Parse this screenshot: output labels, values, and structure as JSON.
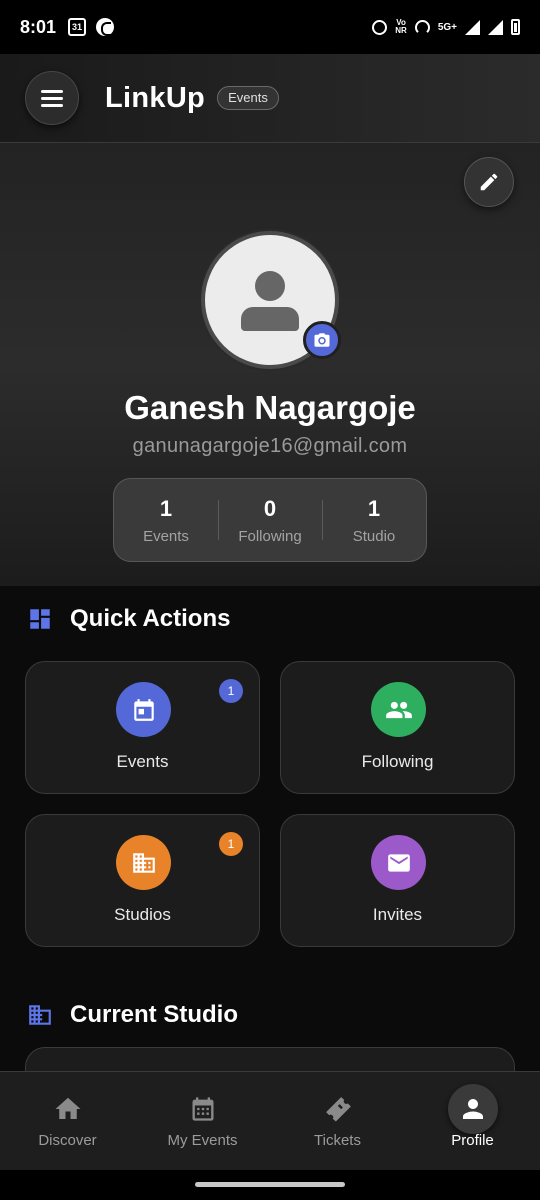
{
  "status_bar": {
    "time": "8:01",
    "calendar_date": "31",
    "volte": "Vo\nNR",
    "network": "5G+"
  },
  "header": {
    "title": "LinkUp",
    "badge": "Events"
  },
  "profile": {
    "name": "Ganesh Nagargoje",
    "email": "ganunagargoje16@gmail.com",
    "stats": [
      {
        "value": "1",
        "label": "Events"
      },
      {
        "value": "0",
        "label": "Following"
      },
      {
        "value": "1",
        "label": "Studio"
      }
    ]
  },
  "quick_actions": {
    "title": "Quick Actions",
    "cards": [
      {
        "label": "Events",
        "badge": "1",
        "icon": "calendar-icon",
        "color": "#5468d8",
        "badge_color": "#5468d8"
      },
      {
        "label": "Following",
        "badge": "",
        "icon": "people-icon",
        "color": "#2eaf5f"
      },
      {
        "label": "Studios",
        "badge": "1",
        "icon": "building-icon",
        "color": "#e8832a",
        "badge_color": "#e8832a"
      },
      {
        "label": "Invites",
        "badge": "",
        "icon": "mail-icon",
        "color": "#9b59c9"
      }
    ]
  },
  "current_studio": {
    "title": "Current Studio"
  },
  "bottom_nav": {
    "items": [
      {
        "label": "Discover",
        "icon": "home-icon",
        "active": false
      },
      {
        "label": "My Events",
        "icon": "calendar-grid-icon",
        "active": false
      },
      {
        "label": "Tickets",
        "icon": "ticket-icon",
        "active": false
      },
      {
        "label": "Profile",
        "icon": "person-icon",
        "active": true
      }
    ]
  },
  "colors": {
    "accent": "#5468d8",
    "green": "#2eaf5f",
    "orange": "#e8832a",
    "purple": "#9b59c9"
  }
}
